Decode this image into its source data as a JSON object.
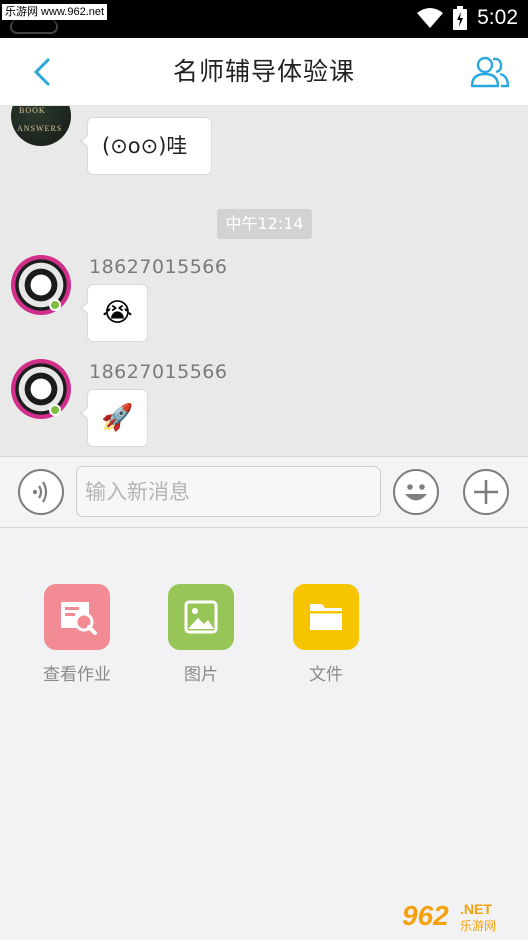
{
  "status_bar": {
    "watermark": "乐游网 www.962.net",
    "time": "5:02"
  },
  "header": {
    "back_icon": "chevron-left-icon",
    "title": "名师辅导体验课",
    "group_icon": "group-members-icon",
    "accent_color": "#29a8e0"
  },
  "chat": {
    "messages": [
      {
        "sender": "",
        "text": "(⊙o⊙)哇"
      },
      {
        "sender": "18627015566",
        "emoji": "😭"
      },
      {
        "sender": "18627015566",
        "emoji": "🚀"
      }
    ],
    "timestamp": "中午12:14"
  },
  "input_bar": {
    "voice_icon": "voice-icon",
    "placeholder": "输入新消息",
    "emoji_icon": "smiley-icon",
    "plus_icon": "plus-icon"
  },
  "attachments": [
    {
      "label": "查看作业",
      "icon": "homework-search-icon",
      "color": "#f28b93"
    },
    {
      "label": "图片",
      "icon": "image-icon",
      "color": "#98c557"
    },
    {
      "label": "文件",
      "icon": "folder-icon",
      "color": "#f7c400"
    }
  ],
  "footer_logo": {
    "text_main": "962",
    "text_suffix": ".NET",
    "text_sub": "乐游网"
  }
}
